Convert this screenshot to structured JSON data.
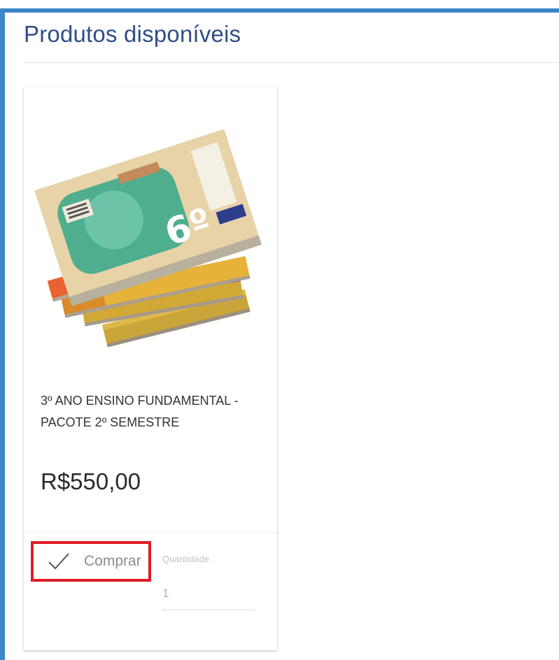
{
  "page": {
    "title": "Produtos disponíveis",
    "accent_color": "#3d84c8",
    "title_color": "#2f4f86"
  },
  "product": {
    "image_icon": "book-stack-image",
    "name": "3º ANO ENSINO FUNDAMENTAL - PACOTE 2º SEMESTRE",
    "price": "R$550,00",
    "buy_label": "Comprar",
    "buy_icon": "check-icon",
    "highlight_color": "#e01b24",
    "quantity": {
      "label": "Quantidade",
      "value": "1"
    }
  }
}
